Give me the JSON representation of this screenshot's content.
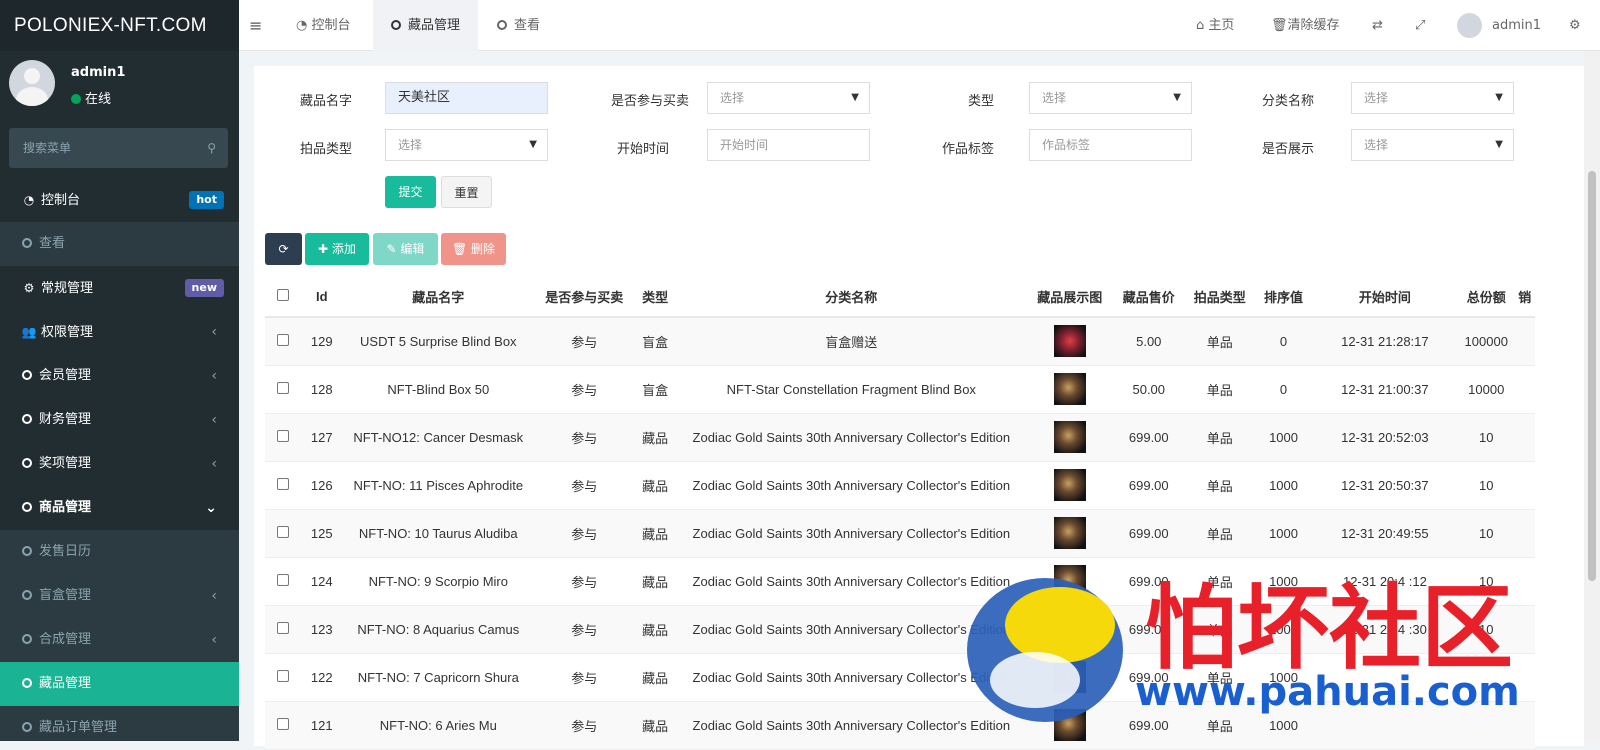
{
  "app": {
    "logo": "POLONIEX-NFT.COM"
  },
  "user": {
    "name": "admin1",
    "status": "在线"
  },
  "sidebar": {
    "search_placeholder": "搜索菜单",
    "items": [
      {
        "label": "控制台",
        "badge": "hot",
        "icon": "dashboard-icon"
      },
      {
        "label": "查看",
        "icon": "circle-icon"
      },
      {
        "label": "常规管理",
        "badge": "new",
        "icon": "cogs-icon"
      },
      {
        "label": "权限管理",
        "icon": "users-icon"
      },
      {
        "label": "会员管理",
        "icon": "circle-icon"
      },
      {
        "label": "财务管理",
        "icon": "circle-icon"
      },
      {
        "label": "奖项管理",
        "icon": "circle-icon"
      },
      {
        "label": "商品管理",
        "icon": "circle-icon"
      },
      {
        "label": "发售日历",
        "icon": "circle-icon"
      },
      {
        "label": "盲盒管理",
        "icon": "circle-icon"
      },
      {
        "label": "合成管理",
        "icon": "circle-icon"
      },
      {
        "label": "藏品管理",
        "icon": "circle-icon"
      },
      {
        "label": "藏品订单管理",
        "icon": "circle-icon"
      }
    ]
  },
  "topbar": {
    "tabs": [
      "控制台",
      "藏品管理",
      "查看"
    ],
    "home": "主页",
    "clear_cache": "清除缓存",
    "user": "admin1"
  },
  "filters": {
    "name_label": "藏品名字",
    "name_value": "天美社区",
    "trade_label": "是否参与买卖",
    "trade_value": "选择",
    "type_label": "类型",
    "type_value": "选择",
    "category_label": "分类名称",
    "category_value": "选择",
    "auction_label": "拍品类型",
    "auction_value": "选择",
    "start_label": "开始时间",
    "start_placeholder": "开始时间",
    "tag_label": "作品标签",
    "tag_placeholder": "作品标签",
    "show_label": "是否展示",
    "show_value": "选择",
    "submit": "提交",
    "reset": "重置"
  },
  "toolbar": {
    "add": "添加",
    "edit": "编辑",
    "delete": "删除"
  },
  "table": {
    "headers": [
      "Id",
      "藏品名字",
      "是否参与买卖",
      "类型",
      "分类名称",
      "藏品展示图",
      "藏品售价",
      "拍品类型",
      "排序值",
      "开始时间",
      "总份额",
      "销"
    ],
    "rows": [
      {
        "id": "129",
        "name": "USDT 5 Surprise Blind Box",
        "trade": "参与",
        "type": "盲盒",
        "category": "盲盒赠送",
        "price": "5.00",
        "auction": "单品",
        "sort": "0",
        "start": "12-31 21:28:17",
        "total": "100000"
      },
      {
        "id": "128",
        "name": "NFT-Blind Box 50",
        "trade": "参与",
        "type": "盲盒",
        "category": "NFT-Star Constellation Fragment Blind Box",
        "price": "50.00",
        "auction": "单品",
        "sort": "0",
        "start": "12-31 21:00:37",
        "total": "10000"
      },
      {
        "id": "127",
        "name": "NFT-NO12: Cancer Desmask",
        "trade": "参与",
        "type": "藏品",
        "category": "Zodiac Gold Saints 30th Anniversary Collector's Edition",
        "price": "699.00",
        "auction": "单品",
        "sort": "1000",
        "start": "12-31 20:52:03",
        "total": "10"
      },
      {
        "id": "126",
        "name": "NFT-NO: 11 Pisces Aphrodite",
        "trade": "参与",
        "type": "藏品",
        "category": "Zodiac Gold Saints 30th Anniversary Collector's Edition",
        "price": "699.00",
        "auction": "单品",
        "sort": "1000",
        "start": "12-31 20:50:37",
        "total": "10"
      },
      {
        "id": "125",
        "name": "NFT-NO: 10 Taurus Aludiba",
        "trade": "参与",
        "type": "藏品",
        "category": "Zodiac Gold Saints 30th Anniversary Collector's Edition",
        "price": "699.00",
        "auction": "单品",
        "sort": "1000",
        "start": "12-31 20:49:55",
        "total": "10"
      },
      {
        "id": "124",
        "name": "NFT-NO: 9 Scorpio Miro",
        "trade": "参与",
        "type": "藏品",
        "category": "Zodiac Gold Saints 30th Anniversary Collector's Edition",
        "price": "699.00",
        "auction": "单品",
        "sort": "1000",
        "start": "12-31 20:4 :12",
        "total": "10"
      },
      {
        "id": "123",
        "name": "NFT-NO: 8 Aquarius Camus",
        "trade": "参与",
        "type": "藏品",
        "category": "Zodiac Gold Saints 30th Anniversary Collector's Edition",
        "price": "699.00",
        "auction": "单品",
        "sort": "1000",
        "start": "12-31 20:4 :30",
        "total": "10"
      },
      {
        "id": "122",
        "name": "NFT-NO: 7 Capricorn Shura",
        "trade": "参与",
        "type": "藏品",
        "category": "Zodiac Gold Saints 30th Anniversary Collector's Edition",
        "price": "699.00",
        "auction": "单品",
        "sort": "1000",
        "start": "",
        "total": ""
      },
      {
        "id": "121",
        "name": "NFT-NO: 6 Aries Mu",
        "trade": "参与",
        "type": "藏品",
        "category": "Zodiac Gold Saints 30th Anniversary Collector's Edition",
        "price": "699.00",
        "auction": "单品",
        "sort": "1000",
        "start": "",
        "total": ""
      }
    ]
  },
  "watermark": {
    "title": "怕坏社区",
    "url": "www.pahuai.com"
  },
  "colors": {
    "sidebar": "#222d32",
    "accent": "#1ab394",
    "green_text": "#18bc9c"
  }
}
